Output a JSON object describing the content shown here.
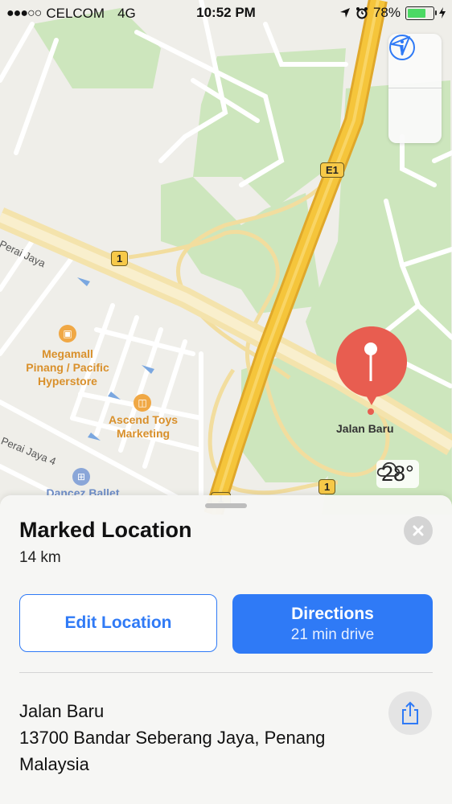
{
  "status_bar": {
    "carrier": "CELCOM",
    "network": "4G",
    "time": "10:52 PM",
    "battery_text": "78%",
    "battery_level": 0.78
  },
  "map": {
    "shields": [
      "E1",
      "1",
      "1",
      "1"
    ],
    "road_labels": [
      "Perai Jaya",
      "Perai Jaya 4"
    ],
    "pois": [
      {
        "name": "Megamall\nPinang / Pacific\nHyperstore",
        "icon": "shopping-icon"
      },
      {
        "name": "Ascend Toys\nMarketing",
        "icon": "bag-icon"
      },
      {
        "name": "Dancez Ballet",
        "icon": "building-icon"
      }
    ],
    "pin_label": "Jalan Baru",
    "weather": "28°",
    "colors": {
      "park": "#cde6bd",
      "highway": "#f5c53b",
      "road": "#ffffff",
      "pin": "#e85d50"
    }
  },
  "card": {
    "title": "Marked Location",
    "distance": "14 km",
    "edit_label": "Edit Location",
    "directions_label": "Directions",
    "directions_sub": "21 min drive",
    "address_line1": "Jalan Baru",
    "address_line2": "13700 Bandar Seberang Jaya, Penang",
    "address_line3": "Malaysia",
    "accent": "#2f7af6"
  }
}
